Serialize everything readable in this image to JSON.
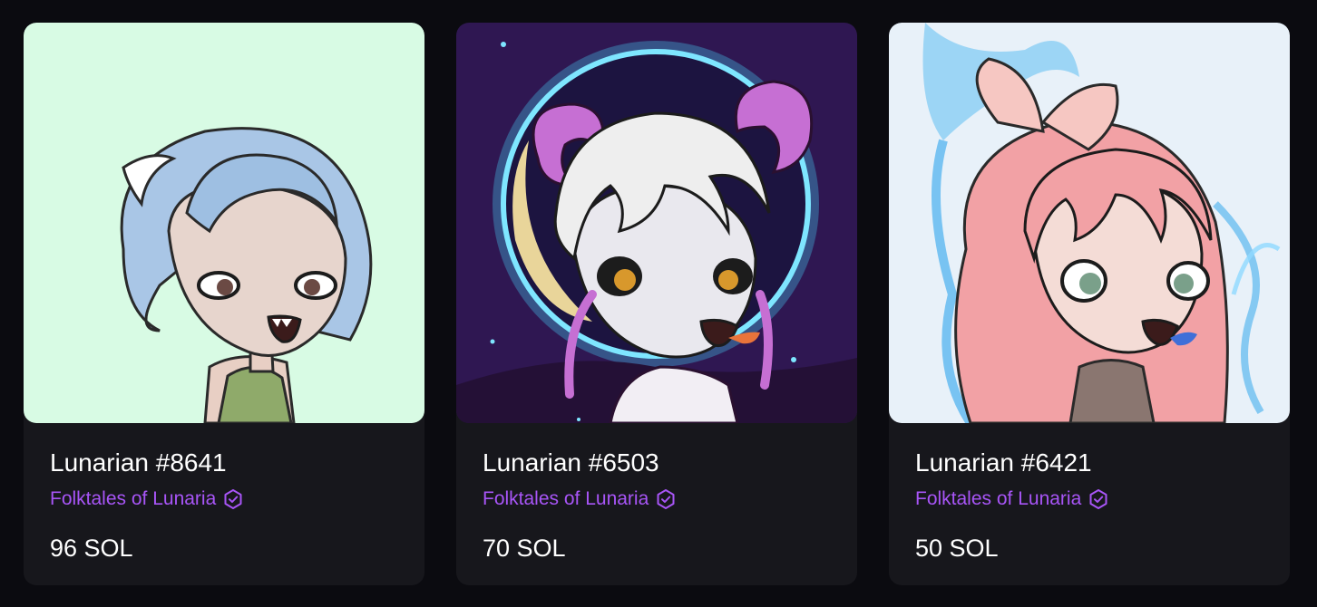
{
  "cards": [
    {
      "name": "Lunarian #8641",
      "collection": "Folktales of Lunaria",
      "price": "96 SOL",
      "background_color": "#d8fbe4",
      "hair_color": "#a9c6e6",
      "eye_color": "#6b4a44",
      "outfit_color": "#8faa6a"
    },
    {
      "name": "Lunarian #6503",
      "collection": "Folktales of Lunaria",
      "price": "70 SOL",
      "background_color": "#2f1752",
      "hair_color": "#eeeeee",
      "eye_color": "#d8982c",
      "outfit_color": "#f2eef4"
    },
    {
      "name": "Lunarian #6421",
      "collection": "Folktales of Lunaria",
      "price": "50 SOL",
      "background_color": "#e8f1f9",
      "hair_color": "#f2a1a5",
      "eye_color": "#7aa08a",
      "outfit_color": "#8a7670"
    }
  ],
  "colors": {
    "page_background": "#0b0b10",
    "card_background": "#17171c",
    "collection_accent": "#a855f7",
    "text_primary": "#ffffff"
  },
  "icons": {
    "verified": "verified-badge-icon"
  }
}
